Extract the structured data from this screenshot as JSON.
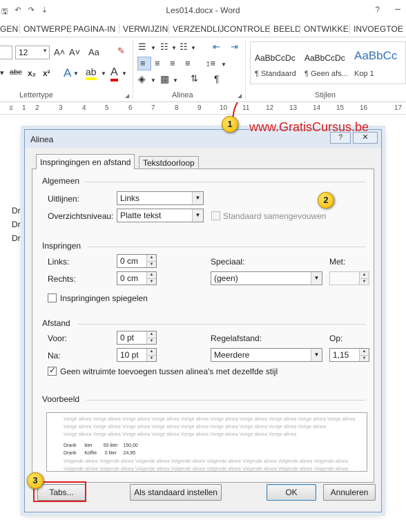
{
  "window": {
    "title": "Les014.docx - Word",
    "help_glyph": "?",
    "minimize_glyph": "–"
  },
  "qat": {
    "save_icon": "save-icon",
    "undo_glyph": "↶",
    "redo_glyph": "↷",
    "customize_glyph": "⇣"
  },
  "ribbon_tabs": [
    "GEN",
    "ONTWERPE",
    "PAGINA-IN",
    "VERWIJZIN",
    "VERZENDLIJ",
    "CONTROLE",
    "BEELD",
    "ONTWIKKE",
    "INVOEGTOE"
  ],
  "ribbon": {
    "font_size": "12",
    "groups": {
      "font": "Lettertype",
      "paragraph": "Alinea",
      "styles": "Stijlen"
    },
    "font_buttons": {
      "grow": "A˄",
      "shrink": "A˅",
      "case": "Aa",
      "strike": "abc",
      "subscript": "x₂",
      "superscript": "x²"
    },
    "styles": [
      {
        "preview": "AaBbCcDc",
        "name": "¶ Standaard"
      },
      {
        "preview": "AaBbCcDc",
        "name": "¶ Geen afs..."
      },
      {
        "preview": "AaBbCc",
        "name": "Kop 1"
      }
    ]
  },
  "ruler": {
    "numbers": [
      "1",
      "2",
      "3",
      "4",
      "5",
      "6",
      "7",
      "8",
      "9",
      "10",
      "11",
      "12",
      "13",
      "14",
      "15",
      "16",
      "17"
    ]
  },
  "document": {
    "lines": [
      "Dra",
      "Dra",
      "Dra"
    ]
  },
  "watermark": "www.GratisCursus.be",
  "badges": [
    "1",
    "2",
    "3"
  ],
  "dialog": {
    "title": "Alinea",
    "help_button": "?",
    "close_button": "✕",
    "tabs": [
      "Inspringingen en afstand",
      "Tekstdoorloop"
    ],
    "general": {
      "heading": "Algemeen",
      "alignment_label": "Uitlijnen:",
      "alignment_value": "Links",
      "outline_label": "Overzichtsniveau:",
      "outline_value": "Platte tekst",
      "collapsed_label": "Standaard samengevouwen"
    },
    "indent": {
      "heading": "Inspringen",
      "left_label": "Links:",
      "left_value": "0 cm",
      "right_label": "Rechts:",
      "right_value": "0 cm",
      "special_label": "Speciaal:",
      "special_value": "(geen)",
      "by_label": "Met:",
      "by_value": "",
      "mirror_label": "Inspringingen spiegelen"
    },
    "spacing": {
      "heading": "Afstand",
      "before_label": "Voor:",
      "before_value": "0 pt",
      "after_label": "Na:",
      "after_value": "10 pt",
      "line_label": "Regelafstand:",
      "line_value": "Meerdere",
      "at_label": "Op:",
      "at_value": "1,15",
      "nospace_label": "Geen witruimte toevoegen tussen alinea's met dezelfde stijl"
    },
    "preview": {
      "heading": "Voorbeeld",
      "prev_lines": [
        "Vorige alinea Vorige alinea Vorige alinea Vorige alinea Vorige alinea Vorige alinea Vorige alinea Vorige alinea Vorige alinea Vorige alinea",
        "Vorige alinea Vorige alinea Vorige alinea Vorige alinea Vorige alinea Vorige alinea Vorige alinea Vorige alinea Vorige alinea",
        "Vorige alinea Vorige alinea Vorige alinea Vorige alinea Vorige alinea Vorige alinea Vorige alinea Vorige alinea"
      ],
      "sample_lines": [
        "Drank      bier        50 liter    150,00",
        "Drank      Koffie      0 liter     24,95"
      ],
      "next_lines": [
        "Volgende alinea Volgende alinea Volgende alinea Volgende alinea Volgende alinea Volgende alinea Volgende alinea Volgende alinea",
        "Volgende alinea Volgende alinea Volgende alinea Volgende alinea Volgende alinea Volgende alinea Volgende alinea Volgende alinea",
        "Volgende alinea Volgende alinea Volgende alinea Volgende alinea Volgende alinea Volgende alinea Volgende alinea Volgende alinea"
      ]
    },
    "buttons": {
      "tabs": "Tabs...",
      "set_default": "Als standaard instellen",
      "ok": "OK",
      "cancel": "Annuleren"
    }
  }
}
